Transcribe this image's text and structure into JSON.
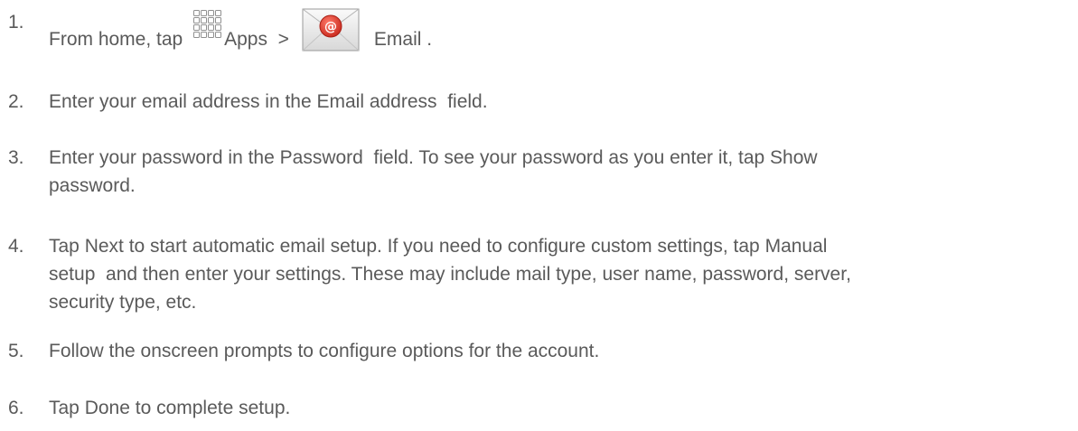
{
  "steps": [
    {
      "number": "1.",
      "text_before_apps": "From home, tap",
      "apps_label": "Apps",
      "separator": ">",
      "email_label": "Email",
      "trailing": ".",
      "apps_icon": "apps-grid-icon",
      "email_icon": "email-envelope-icon"
    },
    {
      "number": "2.",
      "text": "Enter your email address in the Email address  field."
    },
    {
      "number": "3.",
      "line1": "Enter your password in the Password  field. To see your password as you enter it, tap Show",
      "line2": "password."
    },
    {
      "number": "4.",
      "line1": "Tap Next to start automatic email setup. If you need to configure custom settings, tap Manual",
      "line2": "setup  and then enter your settings. These may include mail type, user name, password, server,",
      "line3": "security type, etc."
    },
    {
      "number": "5.",
      "text": "Follow the onscreen prompts to configure options for the account."
    },
    {
      "number": "6.",
      "text": "Tap Done to complete setup."
    }
  ],
  "colors": {
    "text": "#5a5a5a",
    "email_icon_accent": "#e0463a"
  }
}
